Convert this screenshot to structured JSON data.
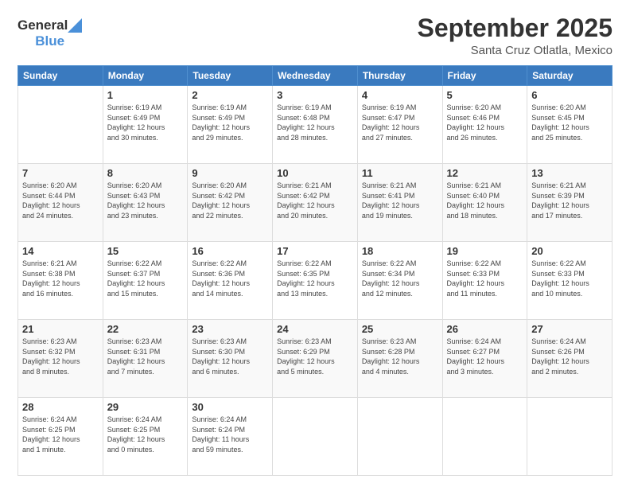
{
  "logo": {
    "text1": "General",
    "text2": "Blue"
  },
  "header": {
    "month": "September 2025",
    "location": "Santa Cruz Otlatla, Mexico"
  },
  "weekdays": [
    "Sunday",
    "Monday",
    "Tuesday",
    "Wednesday",
    "Thursday",
    "Friday",
    "Saturday"
  ],
  "weeks": [
    [
      {
        "day": "",
        "info": ""
      },
      {
        "day": "1",
        "info": "Sunrise: 6:19 AM\nSunset: 6:49 PM\nDaylight: 12 hours\nand 30 minutes."
      },
      {
        "day": "2",
        "info": "Sunrise: 6:19 AM\nSunset: 6:49 PM\nDaylight: 12 hours\nand 29 minutes."
      },
      {
        "day": "3",
        "info": "Sunrise: 6:19 AM\nSunset: 6:48 PM\nDaylight: 12 hours\nand 28 minutes."
      },
      {
        "day": "4",
        "info": "Sunrise: 6:19 AM\nSunset: 6:47 PM\nDaylight: 12 hours\nand 27 minutes."
      },
      {
        "day": "5",
        "info": "Sunrise: 6:20 AM\nSunset: 6:46 PM\nDaylight: 12 hours\nand 26 minutes."
      },
      {
        "day": "6",
        "info": "Sunrise: 6:20 AM\nSunset: 6:45 PM\nDaylight: 12 hours\nand 25 minutes."
      }
    ],
    [
      {
        "day": "7",
        "info": "Sunrise: 6:20 AM\nSunset: 6:44 PM\nDaylight: 12 hours\nand 24 minutes."
      },
      {
        "day": "8",
        "info": "Sunrise: 6:20 AM\nSunset: 6:43 PM\nDaylight: 12 hours\nand 23 minutes."
      },
      {
        "day": "9",
        "info": "Sunrise: 6:20 AM\nSunset: 6:42 PM\nDaylight: 12 hours\nand 22 minutes."
      },
      {
        "day": "10",
        "info": "Sunrise: 6:21 AM\nSunset: 6:42 PM\nDaylight: 12 hours\nand 20 minutes."
      },
      {
        "day": "11",
        "info": "Sunrise: 6:21 AM\nSunset: 6:41 PM\nDaylight: 12 hours\nand 19 minutes."
      },
      {
        "day": "12",
        "info": "Sunrise: 6:21 AM\nSunset: 6:40 PM\nDaylight: 12 hours\nand 18 minutes."
      },
      {
        "day": "13",
        "info": "Sunrise: 6:21 AM\nSunset: 6:39 PM\nDaylight: 12 hours\nand 17 minutes."
      }
    ],
    [
      {
        "day": "14",
        "info": "Sunrise: 6:21 AM\nSunset: 6:38 PM\nDaylight: 12 hours\nand 16 minutes."
      },
      {
        "day": "15",
        "info": "Sunrise: 6:22 AM\nSunset: 6:37 PM\nDaylight: 12 hours\nand 15 minutes."
      },
      {
        "day": "16",
        "info": "Sunrise: 6:22 AM\nSunset: 6:36 PM\nDaylight: 12 hours\nand 14 minutes."
      },
      {
        "day": "17",
        "info": "Sunrise: 6:22 AM\nSunset: 6:35 PM\nDaylight: 12 hours\nand 13 minutes."
      },
      {
        "day": "18",
        "info": "Sunrise: 6:22 AM\nSunset: 6:34 PM\nDaylight: 12 hours\nand 12 minutes."
      },
      {
        "day": "19",
        "info": "Sunrise: 6:22 AM\nSunset: 6:33 PM\nDaylight: 12 hours\nand 11 minutes."
      },
      {
        "day": "20",
        "info": "Sunrise: 6:22 AM\nSunset: 6:33 PM\nDaylight: 12 hours\nand 10 minutes."
      }
    ],
    [
      {
        "day": "21",
        "info": "Sunrise: 6:23 AM\nSunset: 6:32 PM\nDaylight: 12 hours\nand 8 minutes."
      },
      {
        "day": "22",
        "info": "Sunrise: 6:23 AM\nSunset: 6:31 PM\nDaylight: 12 hours\nand 7 minutes."
      },
      {
        "day": "23",
        "info": "Sunrise: 6:23 AM\nSunset: 6:30 PM\nDaylight: 12 hours\nand 6 minutes."
      },
      {
        "day": "24",
        "info": "Sunrise: 6:23 AM\nSunset: 6:29 PM\nDaylight: 12 hours\nand 5 minutes."
      },
      {
        "day": "25",
        "info": "Sunrise: 6:23 AM\nSunset: 6:28 PM\nDaylight: 12 hours\nand 4 minutes."
      },
      {
        "day": "26",
        "info": "Sunrise: 6:24 AM\nSunset: 6:27 PM\nDaylight: 12 hours\nand 3 minutes."
      },
      {
        "day": "27",
        "info": "Sunrise: 6:24 AM\nSunset: 6:26 PM\nDaylight: 12 hours\nand 2 minutes."
      }
    ],
    [
      {
        "day": "28",
        "info": "Sunrise: 6:24 AM\nSunset: 6:25 PM\nDaylight: 12 hours\nand 1 minute."
      },
      {
        "day": "29",
        "info": "Sunrise: 6:24 AM\nSunset: 6:25 PM\nDaylight: 12 hours\nand 0 minutes."
      },
      {
        "day": "30",
        "info": "Sunrise: 6:24 AM\nSunset: 6:24 PM\nDaylight: 11 hours\nand 59 minutes."
      },
      {
        "day": "",
        "info": ""
      },
      {
        "day": "",
        "info": ""
      },
      {
        "day": "",
        "info": ""
      },
      {
        "day": "",
        "info": ""
      }
    ]
  ]
}
